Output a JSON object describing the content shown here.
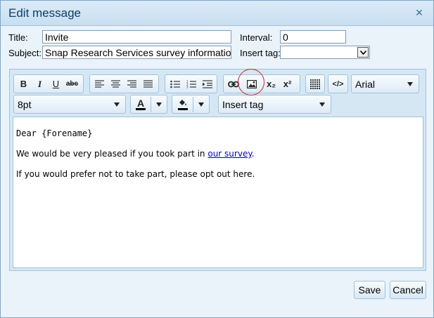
{
  "dialog": {
    "title": "Edit message",
    "close_glyph": "×"
  },
  "form": {
    "title_label": "Title:",
    "title_value": "Invite",
    "subject_label": "Subject:",
    "subject_value": "Snap Research Services survey information",
    "interval_label": "Interval:",
    "interval_value": "0",
    "insert_tag_label": "Insert tag:",
    "insert_tag_value": ""
  },
  "toolbar": {
    "bold": "B",
    "italic": "I",
    "underline": "U",
    "strike": "abc",
    "subscript": "x₂",
    "superscript": "x²",
    "font_name": "Arial",
    "font_size": "8pt",
    "font_color_glyph": "A",
    "insert_tag": "Insert tag",
    "source_glyph": "</>",
    "icons": [
      "bold-icon",
      "italic-icon",
      "underline-icon",
      "strikethrough-icon",
      "align-left-icon",
      "align-center-icon",
      "align-right-icon",
      "align-justify-icon",
      "bullet-list-icon",
      "numbered-list-icon",
      "indent-icon",
      "link-icon",
      "image-icon",
      "subscript-icon",
      "superscript-icon",
      "table-icon",
      "html-source-icon",
      "font-color-icon",
      "background-color-icon"
    ]
  },
  "editor": {
    "line1": "Dear {Forename}",
    "line2_text": "We would be very pleased if you took part in ",
    "line2_link": "our survey",
    "line2_end": ".",
    "line3": "If you would prefer not to take part, please opt out here."
  },
  "footer": {
    "save": "Save",
    "cancel": "Cancel"
  },
  "colors": {
    "accent_circle": "#d62222",
    "link": "#0000cc",
    "title_text": "#0e3d66"
  }
}
